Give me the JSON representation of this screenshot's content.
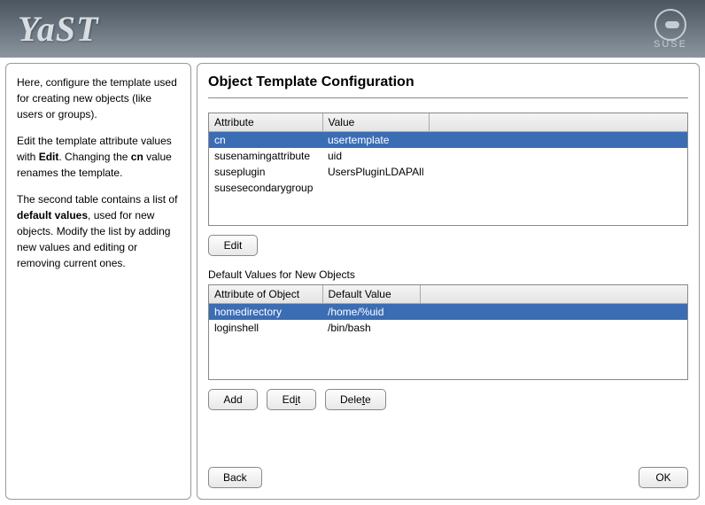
{
  "header": {
    "logo": "YaST",
    "brand": "SUSE"
  },
  "sidebar": {
    "p1a": "Here, configure the template used for creating new objects (like users or groups).",
    "p2a": "Edit the template attribute values with ",
    "p2b": "Edit",
    "p2c": ". Changing the ",
    "p2d": "cn",
    "p2e": " value renames the template.",
    "p3a": "The second table contains a list of ",
    "p3b": "default values",
    "p3c": ", used for new objects. Modify the list by adding new values and editing or removing current ones."
  },
  "main": {
    "title": "Object Template Configuration",
    "table1": {
      "col1": "Attribute",
      "col2": "Value",
      "rows": [
        {
          "attr": "cn",
          "val": "usertemplate",
          "selected": true
        },
        {
          "attr": "susenamingattribute",
          "val": "uid"
        },
        {
          "attr": "suseplugin",
          "val": "UsersPluginLDAPAll"
        },
        {
          "attr": "susesecondarygroup",
          "val": ""
        }
      ]
    },
    "edit1": "Edit",
    "section_label": "Default Values for New Objects",
    "table2": {
      "col1": "Attribute of Object",
      "col2": "Default Value",
      "rows": [
        {
          "attr": "homedirectory",
          "val": "/home/%uid",
          "selected": true
        },
        {
          "attr": "loginshell",
          "val": "/bin/bash"
        }
      ]
    },
    "buttons": {
      "add": "Add",
      "edit": "Edit",
      "delete": "Delete",
      "back": "Back",
      "ok": "OK"
    }
  }
}
